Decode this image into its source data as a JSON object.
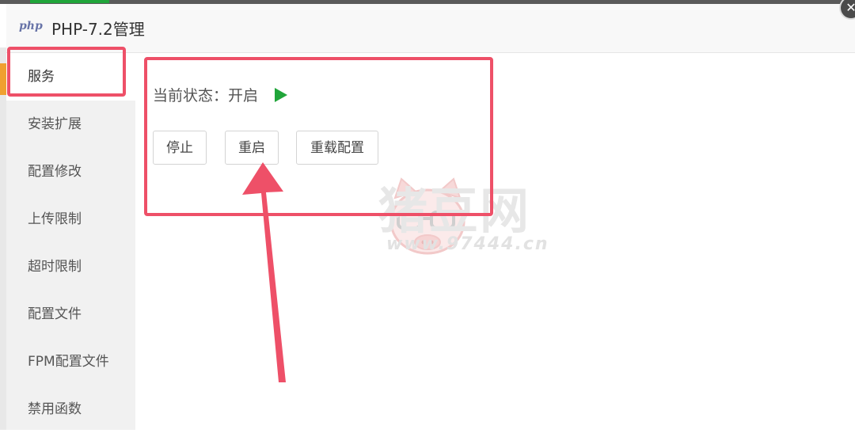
{
  "dialog": {
    "logo_text": "php",
    "title": "PHP-7.2管理",
    "close_glyph": "✕"
  },
  "sidebar": {
    "items": [
      {
        "label": "服务",
        "active": true
      },
      {
        "label": "安装扩展"
      },
      {
        "label": "配置修改"
      },
      {
        "label": "上传限制"
      },
      {
        "label": "超时限制"
      },
      {
        "label": "配置文件"
      },
      {
        "label": "FPM配置文件"
      },
      {
        "label": "禁用函数"
      }
    ]
  },
  "service": {
    "status_label": "当前状态：",
    "status_value": "开启",
    "status_icon": "play-icon",
    "status_color": "#20a53a",
    "buttons": {
      "stop": "停止",
      "restart": "重启",
      "reload": "重载配置"
    }
  },
  "watermark": {
    "brand": "猪豆网",
    "url": "www.97444.cn"
  },
  "colors": {
    "annotation": "#ee5068",
    "accent_green": "#20a53a"
  }
}
